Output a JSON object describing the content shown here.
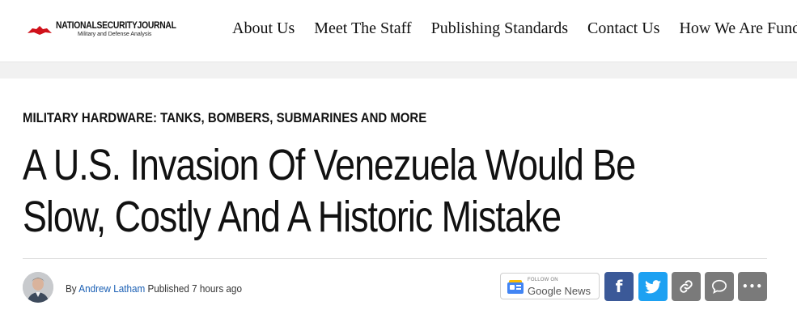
{
  "site": {
    "logo_name": "NATIONALSECURITYJOURNAL",
    "logo_tagline": "Military and Defense Analysis"
  },
  "nav": {
    "items": [
      "About Us",
      "Meet The Staff",
      "Publishing Standards",
      "Contact Us",
      "How We Are Funded"
    ]
  },
  "article": {
    "category": "MILITARY HARDWARE: TANKS, BOMBERS, SUBMARINES AND MORE",
    "title": "A U.S. Invasion Of Venezuela Would Be Slow, Costly And A Historic Mistake",
    "byline_prefix": "By",
    "author": "Andrew Latham",
    "published_label": "Published",
    "published_time": "7 hours ago"
  },
  "google_news": {
    "follow_label": "FOLLOW ON",
    "name": "Google News"
  },
  "share": {
    "facebook_glyph": "f",
    "more_glyph": "•••"
  },
  "colors": {
    "facebook": "#3b5998",
    "twitter": "#1da1f2",
    "gray_button": "#7a7a7a",
    "author_link": "#1a5fb4",
    "logo_red": "#d0121b"
  }
}
